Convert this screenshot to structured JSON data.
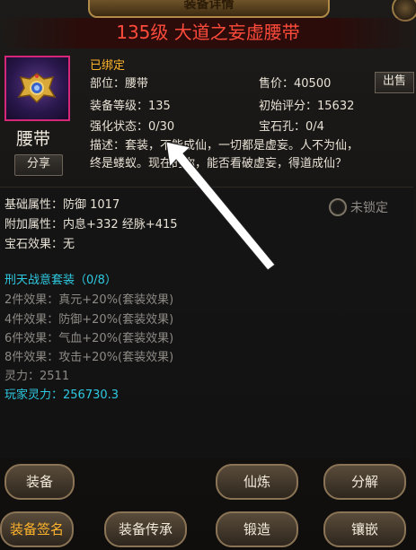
{
  "header": {
    "banner_text": "装备详情",
    "title": "135级 大道之妄虚腰带"
  },
  "item": {
    "name": "腰带",
    "share_label": "分享",
    "bound_label": "已绑定",
    "slot": "部位：腰带",
    "level": "装备等级：135",
    "enhance": "强化状态：0/30",
    "price": "售价：40500",
    "score": "初始评分：15632",
    "gems": "宝石孔：0/4",
    "sell_label": "出售",
    "desc_line1": "描述：套装，不能成仙，一切都是虚妄。人不为仙，",
    "desc_line2": "终是蝼蚁。现在的你，能否看破虚妄，得道成仙？"
  },
  "attrs": {
    "base": "基础属性：防御 1017",
    "extra": "附加属性：内息+332 经脉+415",
    "gem_effect": "宝石效果：无",
    "lock_label": "未锁定"
  },
  "set": {
    "title": "刑天战意套装（0/8）",
    "effects": [
      "2件效果：真元+20%(套装效果)",
      "4件效果：防御+20%(套装效果)",
      "6件效果：气血+20%(套装效果)",
      "8件效果：攻击+20%(套装效果)"
    ],
    "spirit": "灵力：2511",
    "player_spirit": "玩家灵力：256730.3"
  },
  "buttons": {
    "equip": "装备",
    "refine": "仙炼",
    "decompose": "分解",
    "sign": "装备签名",
    "inherit": "装备传承",
    "forge": "锻造",
    "inlay": "镶嵌"
  },
  "colors": {
    "title_red": "#ff4b3b",
    "bound_orange": "#ffb52a",
    "set_cyan": "#2ec9e0",
    "icon_border": "#d6267a"
  }
}
